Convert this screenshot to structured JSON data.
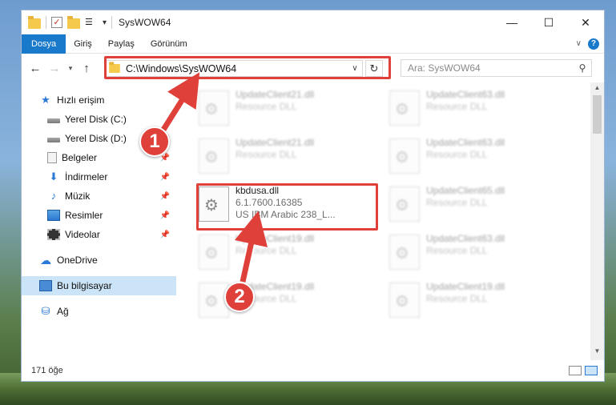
{
  "window": {
    "title": "SysWOW64",
    "controls": {
      "minimize": "—",
      "maximize": "☐",
      "close": "✕"
    }
  },
  "ribbon": {
    "tabs": [
      "Dosya",
      "Giriş",
      "Paylaş",
      "Görünüm"
    ]
  },
  "nav": {
    "address": "C:\\Windows\\SysWOW64",
    "search_placeholder": "Ara: SysWOW64"
  },
  "sidebar": {
    "items": [
      {
        "label": "Hızlı erişim",
        "icon": "star-icon",
        "pinned": false
      },
      {
        "label": "Yerel Disk (C:)",
        "icon": "drive-icon",
        "pinned": false
      },
      {
        "label": "Yerel Disk (D:)",
        "icon": "drive-icon",
        "pinned": true
      },
      {
        "label": "Belgeler",
        "icon": "documents-icon",
        "pinned": true
      },
      {
        "label": "İndirmeler",
        "icon": "downloads-icon",
        "pinned": true
      },
      {
        "label": "Müzik",
        "icon": "music-icon",
        "pinned": true
      },
      {
        "label": "Resimler",
        "icon": "pictures-icon",
        "pinned": true
      },
      {
        "label": "Videolar",
        "icon": "videos-icon",
        "pinned": true
      },
      {
        "label": "OneDrive",
        "icon": "cloud-icon",
        "pinned": false
      },
      {
        "label": "Bu bilgisayar",
        "icon": "computer-icon",
        "pinned": false,
        "selected": true
      },
      {
        "label": "Ağ",
        "icon": "network-icon",
        "pinned": false
      }
    ]
  },
  "files": {
    "left": [
      {
        "name": "UpdateClient21.dll",
        "sub": "Resource DLL"
      },
      {
        "name": "UpdateClient21.dll",
        "sub": "Resource DLL"
      },
      {
        "name": "UpdateClient19.dll",
        "sub": "Resource DLL"
      },
      {
        "name": "UpdateClient19.dll",
        "sub": "Resource DLL"
      }
    ],
    "right": [
      {
        "name": "UpdateClient63.dll",
        "sub": "Resource DLL"
      },
      {
        "name": "UpdateClient63.dll",
        "sub": "Resource DLL"
      },
      {
        "name": "UpdateClient65.dll",
        "sub": "Resource DLL"
      },
      {
        "name": "UpdateClient63.dll",
        "sub": "Resource DLL"
      },
      {
        "name": "UpdateClient19.dll",
        "sub": "Resource DLL"
      }
    ],
    "highlighted": {
      "name": "kbdusa.dll",
      "version": "6.1.7600.16385",
      "description": "US IBM Arabic 238_L..."
    }
  },
  "status": {
    "count": "171 öğe"
  },
  "callouts": [
    "1",
    "2"
  ],
  "colors": {
    "accent": "#1979ca",
    "highlight": "#e0403a",
    "selection": "#cce4f7"
  }
}
